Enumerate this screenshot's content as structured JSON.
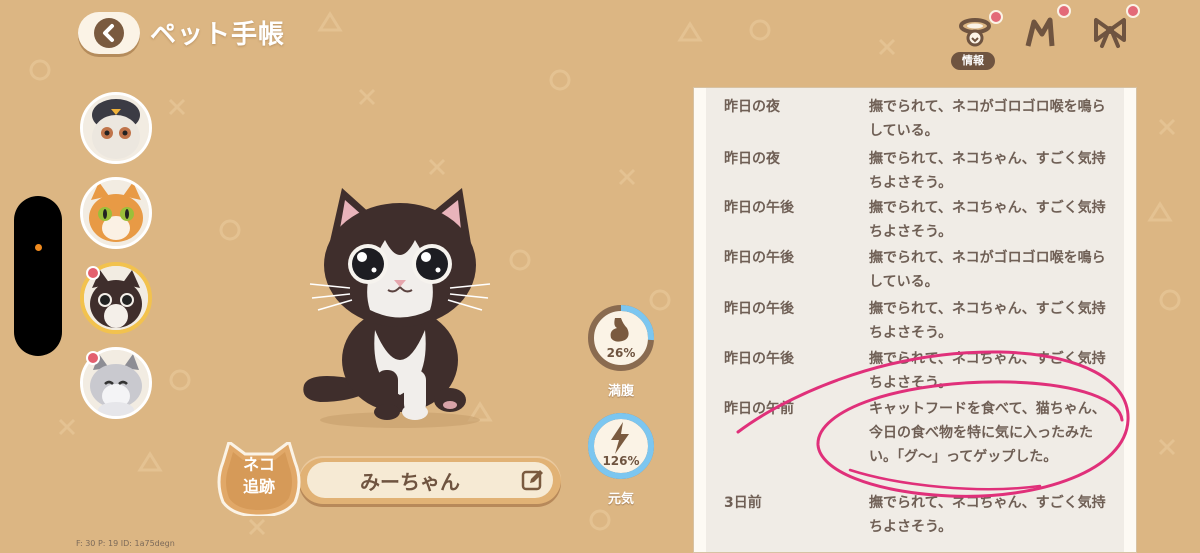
{
  "header": {
    "title": "ペット手帳",
    "back_icon": "chevron-left-icon",
    "tabs": [
      {
        "icon": "cat-collar-icon",
        "label": "情報",
        "active": true
      },
      {
        "icon": "cat-ears-icon",
        "active": false
      },
      {
        "icon": "ribbon-bow-icon",
        "active": false
      }
    ]
  },
  "pets": [
    {
      "name_icon": "penguin-costume-cat-avatar"
    },
    {
      "name_icon": "orange-tabby-cat-avatar"
    },
    {
      "name_icon": "tuxedo-cat-avatar",
      "selected": true
    },
    {
      "name_icon": "gray-white-cat-avatar"
    }
  ],
  "pet": {
    "name": "みーちゃん",
    "track_label_line1": "ネコ",
    "track_label_line2": "追跡"
  },
  "stats": {
    "fullness": {
      "value": "26%",
      "fraction": 0.26,
      "label": "満腹"
    },
    "energy": {
      "value": "126%",
      "fraction": 1.0,
      "label": "元気"
    }
  },
  "debug_text": "F: 30   P: 19   ID: 1a75degn",
  "log": [
    {
      "time": "昨日の夜",
      "message": "撫でられて、ネコがゴロゴロ喉を鳴らしている。"
    },
    {
      "time": "昨日の夜",
      "message": "撫でられて、ネコちゃん、すごく気持ちよさそう。"
    },
    {
      "time": "昨日の午後",
      "message": "撫でられて、ネコちゃん、すごく気持ちよさそう。"
    },
    {
      "time": "昨日の午後",
      "message": "撫でられて、ネコがゴロゴロ喉を鳴らしている。"
    },
    {
      "time": "昨日の午後",
      "message": "撫でられて、ネコちゃん、すごく気持ちよさそう。"
    },
    {
      "time": "昨日の午後",
      "message": "撫でられて、ネコちゃん、すごく気持ちよさそう。"
    },
    {
      "time": "昨日の午前",
      "message": "キャットフードを食べて、猫ちゃん、今日の食べ物を特に気に入ったみたい。「グ〜」ってゲップした。"
    },
    {
      "time": "3日前",
      "message": "撫でられて、ネコちゃん、すごく気持ちよさそう。"
    }
  ],
  "colors": {
    "background": "#dcb683",
    "accent_brown": "#6f5440",
    "highlight_ring": "#f2c24e",
    "annotation_pink": "#e0307a",
    "stat_blue": "#7cc6f0"
  }
}
